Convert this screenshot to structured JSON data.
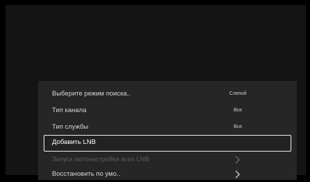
{
  "menu": {
    "rows": [
      {
        "label": "Выберите режим поиска..",
        "value": "Слепой"
      },
      {
        "label": "Тип канала",
        "value": "Все"
      },
      {
        "label": "Тип службы",
        "value": "Все"
      },
      {
        "label": "Добавить LNB"
      },
      {
        "label": "Запуск автонастройки всех LNB",
        "icon": "chevron-right-icon"
      },
      {
        "label": "Восстановить по умо..",
        "icon": "chevron-right-icon"
      }
    ]
  },
  "colors": {
    "background": "#000000",
    "screen": "#141414",
    "panel": "#262626",
    "text": "#d6d6d6",
    "disabled_text": "#5b5b5b",
    "selection_border": "#f2f2f2"
  }
}
